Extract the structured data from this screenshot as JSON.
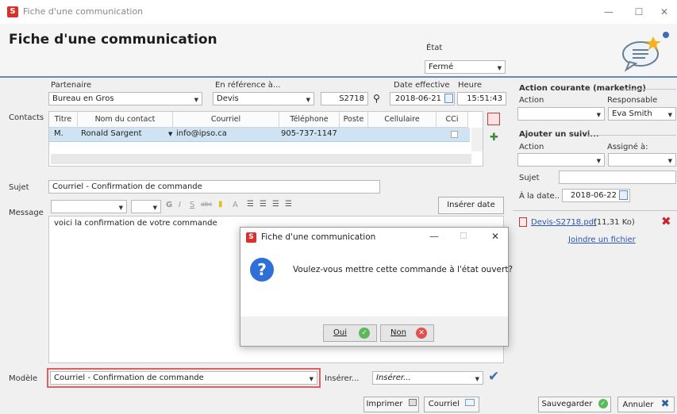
{
  "window": {
    "title": "Fiche d'une communication",
    "minimize": "—",
    "maximize": "☐",
    "close": "✕"
  },
  "header": {
    "title": "Fiche d'une communication",
    "etat_label": "État",
    "etat_value": "Fermé"
  },
  "top": {
    "partenaire_label": "Partenaire",
    "partenaire_value": "Bureau en Gros",
    "reference_label": "En référence à...",
    "reference_value": "Devis",
    "reference_num": "S2718",
    "date_label": "Date effective",
    "date_value": "2018-06-21",
    "heure_label": "Heure",
    "heure_value": "15:51:43"
  },
  "contacts": {
    "label": "Contacts",
    "columns": [
      "Titre",
      "Nom du contact",
      "Courriel",
      "Téléphone",
      "Poste",
      "Cellulaire",
      "CCi"
    ],
    "rows": [
      {
        "titre": "M.",
        "nom": "Ronald Sargent",
        "courriel": "info@ipso.ca",
        "telephone": "905-737-1147"
      }
    ]
  },
  "sujet": {
    "label": "Sujet",
    "value": "Courriel - Confirmation de commande"
  },
  "message": {
    "label": "Message",
    "body": "voici la confirmation de votre commande",
    "inserer_date": "Insérer date"
  },
  "toolbar": {
    "bold": "G",
    "italic": "I",
    "underline": "S",
    "strike": "abc",
    "font": "A"
  },
  "right": {
    "action_courante_label": "Action courante (marketing)",
    "action_label": "Action",
    "responsable_label": "Responsable",
    "responsable_value": "Eva Smith",
    "suivi_label": "Ajouter un suivi...",
    "suivi_action_label": "Action",
    "assigne_label": "Assigné à:",
    "sujet_label": "Sujet",
    "date_label": "À la date..",
    "date_value": "2018-06-22",
    "file_name": "Devis-S2718.pdf",
    "file_size": "(11,31 Ko)",
    "joindre": "Joindre un fichier"
  },
  "dialog": {
    "title": "Fiche d'une communication",
    "question": "Voulez-vous mettre cette commande à l'état ouvert?",
    "oui": "Oui",
    "non": "Non"
  },
  "footer": {
    "modele_label": "Modèle",
    "modele_value": "Courriel - Confirmation de commande",
    "inserer_label": "Insérer...",
    "inserer_placeholder": "Insérer...",
    "imprimer": "Imprimer",
    "courriel": "Courriel",
    "sauvegarder": "Sauvegarder",
    "annuler": "Annuler"
  },
  "colors": {
    "accent": "#2a55b8",
    "highlight": "#e06060",
    "row_selected": "#cfe3f2",
    "brand_red": "#d9302c"
  }
}
